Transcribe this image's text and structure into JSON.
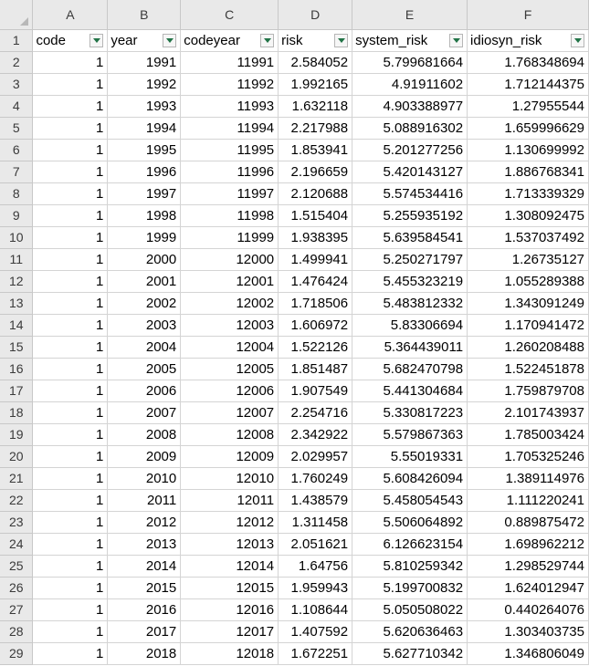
{
  "columns": [
    "A",
    "B",
    "C",
    "D",
    "E",
    "F"
  ],
  "row_numbers": [
    "1",
    "2",
    "3",
    "4",
    "5",
    "6",
    "7",
    "8",
    "9",
    "10",
    "11",
    "12",
    "13",
    "14",
    "15",
    "16",
    "17",
    "18",
    "19",
    "20",
    "21",
    "22",
    "23",
    "24",
    "25",
    "26",
    "27",
    "28",
    "29"
  ],
  "headers": [
    "code",
    "year",
    "codeyear",
    "risk",
    "system_risk",
    "idiosyn_risk"
  ],
  "rows": [
    [
      "1",
      "1991",
      "11991",
      "2.584052",
      "5.799681664",
      "1.768348694"
    ],
    [
      "1",
      "1992",
      "11992",
      "1.992165",
      "4.91911602",
      "1.712144375"
    ],
    [
      "1",
      "1993",
      "11993",
      "1.632118",
      "4.903388977",
      "1.27955544"
    ],
    [
      "1",
      "1994",
      "11994",
      "2.217988",
      "5.088916302",
      "1.659996629"
    ],
    [
      "1",
      "1995",
      "11995",
      "1.853941",
      "5.201277256",
      "1.130699992"
    ],
    [
      "1",
      "1996",
      "11996",
      "2.196659",
      "5.420143127",
      "1.886768341"
    ],
    [
      "1",
      "1997",
      "11997",
      "2.120688",
      "5.574534416",
      "1.713339329"
    ],
    [
      "1",
      "1998",
      "11998",
      "1.515404",
      "5.255935192",
      "1.308092475"
    ],
    [
      "1",
      "1999",
      "11999",
      "1.938395",
      "5.639584541",
      "1.537037492"
    ],
    [
      "1",
      "2000",
      "12000",
      "1.499941",
      "5.250271797",
      "1.26735127"
    ],
    [
      "1",
      "2001",
      "12001",
      "1.476424",
      "5.455323219",
      "1.055289388"
    ],
    [
      "1",
      "2002",
      "12002",
      "1.718506",
      "5.483812332",
      "1.343091249"
    ],
    [
      "1",
      "2003",
      "12003",
      "1.606972",
      "5.83306694",
      "1.170941472"
    ],
    [
      "1",
      "2004",
      "12004",
      "1.522126",
      "5.364439011",
      "1.260208488"
    ],
    [
      "1",
      "2005",
      "12005",
      "1.851487",
      "5.682470798",
      "1.522451878"
    ],
    [
      "1",
      "2006",
      "12006",
      "1.907549",
      "5.441304684",
      "1.759879708"
    ],
    [
      "1",
      "2007",
      "12007",
      "2.254716",
      "5.330817223",
      "2.101743937"
    ],
    [
      "1",
      "2008",
      "12008",
      "2.342922",
      "5.579867363",
      "1.785003424"
    ],
    [
      "1",
      "2009",
      "12009",
      "2.029957",
      "5.55019331",
      "1.705325246"
    ],
    [
      "1",
      "2010",
      "12010",
      "1.760249",
      "5.608426094",
      "1.389114976"
    ],
    [
      "1",
      "2011",
      "12011",
      "1.438579",
      "5.458054543",
      "1.111220241"
    ],
    [
      "1",
      "2012",
      "12012",
      "1.311458",
      "5.506064892",
      "0.889875472"
    ],
    [
      "1",
      "2013",
      "12013",
      "2.051621",
      "6.126623154",
      "1.698962212"
    ],
    [
      "1",
      "2014",
      "12014",
      "1.64756",
      "5.810259342",
      "1.298529744"
    ],
    [
      "1",
      "2015",
      "12015",
      "1.959943",
      "5.199700832",
      "1.624012947"
    ],
    [
      "1",
      "2016",
      "12016",
      "1.108644",
      "5.050508022",
      "0.440264076"
    ],
    [
      "1",
      "2017",
      "12017",
      "1.407592",
      "5.620636463",
      "1.303403735"
    ],
    [
      "1",
      "2018",
      "12018",
      "1.672251",
      "5.627710342",
      "1.346806049"
    ]
  ],
  "icons": {
    "corner": "select-all-triangle-icon",
    "filter": "filter-dropdown-icon"
  },
  "colors": {
    "filter_arrow": "#217346",
    "header_bg": "#e9e9e9",
    "gridline": "#d4d4d4"
  }
}
